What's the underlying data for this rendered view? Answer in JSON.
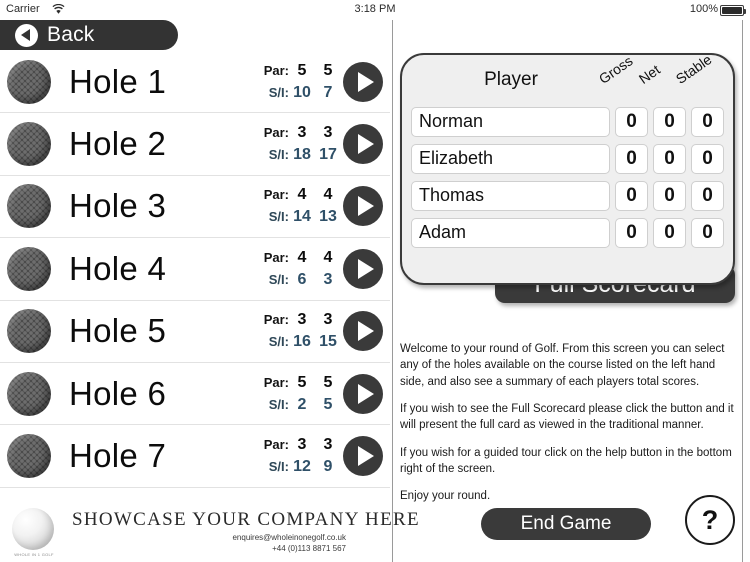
{
  "status_bar": {
    "carrier": "Carrier",
    "wifi_icon": "wifi-icon",
    "time": "3:18 PM",
    "battery_percent": "100%",
    "battery_icon": "battery-full-icon"
  },
  "nav": {
    "back_label": "Back",
    "back_icon": "back-chevron-icon"
  },
  "holes": {
    "par_label": "Par:",
    "si_label": "S/I:",
    "ball_icon": "golf-ball-icon",
    "play_icon": "play-arrow-icon",
    "items": [
      {
        "name": "Hole 1",
        "par1": "5",
        "par2": "5",
        "si1": "10",
        "si2": "7"
      },
      {
        "name": "Hole 2",
        "par1": "3",
        "par2": "3",
        "si1": "18",
        "si2": "17"
      },
      {
        "name": "Hole 3",
        "par1": "4",
        "par2": "4",
        "si1": "14",
        "si2": "13"
      },
      {
        "name": "Hole 4",
        "par1": "4",
        "par2": "4",
        "si1": "6",
        "si2": "3"
      },
      {
        "name": "Hole 5",
        "par1": "3",
        "par2": "3",
        "si1": "16",
        "si2": "15"
      },
      {
        "name": "Hole 6",
        "par1": "5",
        "par2": "5",
        "si1": "2",
        "si2": "5"
      },
      {
        "name": "Hole 7",
        "par1": "3",
        "par2": "3",
        "si1": "12",
        "si2": "9"
      }
    ]
  },
  "scorecard": {
    "header_player": "Player",
    "header_gross": "Gross",
    "header_net": "Net",
    "header_stable": "Stable",
    "rows": [
      {
        "player": "Norman",
        "gross": "0",
        "net": "0",
        "stable": "0"
      },
      {
        "player": "Elizabeth",
        "gross": "0",
        "net": "0",
        "stable": "0"
      },
      {
        "player": "Thomas",
        "gross": "0",
        "net": "0",
        "stable": "0"
      },
      {
        "player": "Adam",
        "gross": "0",
        "net": "0",
        "stable": "0"
      }
    ],
    "full_scorecard_label": "Full Scorecard"
  },
  "info": {
    "p1": "Welcome to your round of Golf. From this screen you can select any of the holes available on the course listed on the left hand side, and also see a summary of each players total scores.",
    "p2": "If you wish to see the Full Scorecard please click the button and it will present the full card as viewed in the traditional manner.",
    "p3": "If you wish for a guided tour click on the help button in the bottom right of the screen.",
    "p4": "Enjoy your round."
  },
  "actions": {
    "end_game_label": "End Game",
    "help_label": "?",
    "help_icon": "question-mark-icon"
  },
  "advert": {
    "ball_icon": "golf-ball-logo-icon",
    "logo_caption": "WHOLE IN 1 GOLF",
    "title": "SHOWCASE YOUR COMPANY HERE",
    "email": "enquires@wholeinonegolf.co.uk",
    "phone": "+44 (0)113 8871 567"
  },
  "colors": {
    "dark": "#3a3a3a",
    "panel_bg": "#efefef",
    "si_text": "#2f5068",
    "divider": "#9a9a9a"
  }
}
